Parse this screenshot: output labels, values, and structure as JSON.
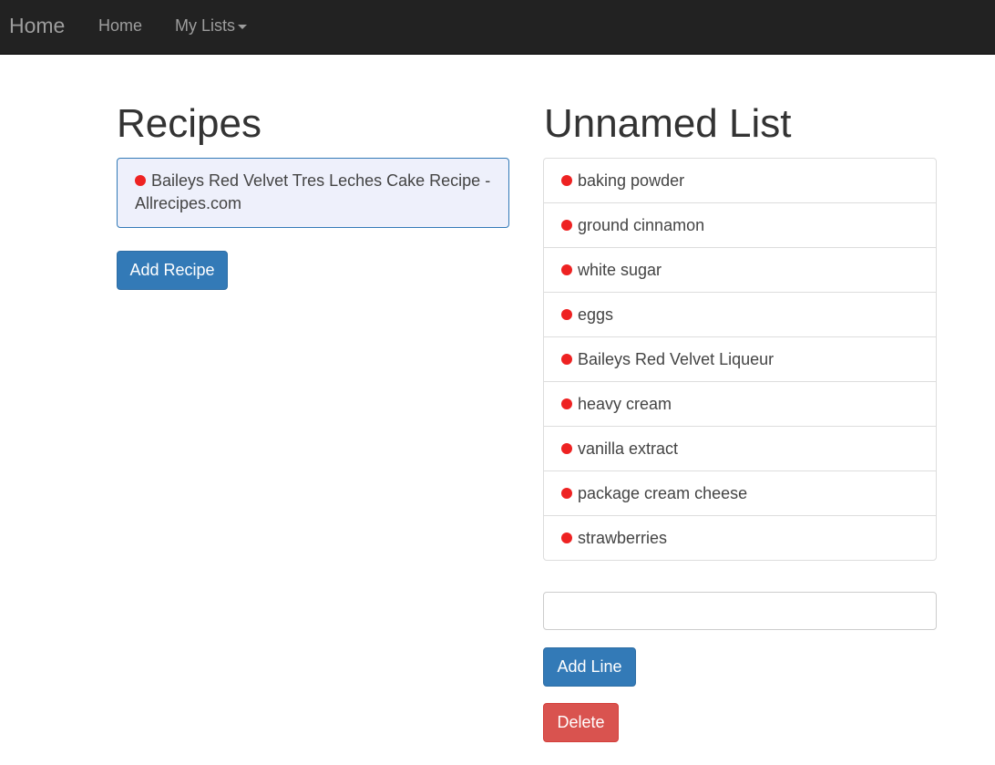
{
  "navbar": {
    "brand": "Home",
    "links": [
      {
        "label": "Home"
      },
      {
        "label": "My Lists",
        "has_dropdown": true
      }
    ]
  },
  "recipes": {
    "heading": "Recipes",
    "items": [
      {
        "label": "Baileys Red Velvet Tres Leches Cake Recipe - Allrecipes.com",
        "status_color": "#ee2222"
      }
    ],
    "add_button": "Add Recipe"
  },
  "list": {
    "heading": "Unnamed List",
    "items": [
      {
        "label": "baking powder",
        "status_color": "#ee2222"
      },
      {
        "label": "ground cinnamon",
        "status_color": "#ee2222"
      },
      {
        "label": "white sugar",
        "status_color": "#ee2222"
      },
      {
        "label": "eggs",
        "status_color": "#ee2222"
      },
      {
        "label": "Baileys Red Velvet Liqueur",
        "status_color": "#ee2222"
      },
      {
        "label": "heavy cream",
        "status_color": "#ee2222"
      },
      {
        "label": "vanilla extract",
        "status_color": "#ee2222"
      },
      {
        "label": "package cream cheese",
        "status_color": "#ee2222"
      },
      {
        "label": "strawberries",
        "status_color": "#ee2222"
      }
    ],
    "input_value": "",
    "input_placeholder": "",
    "add_line_button": "Add Line",
    "delete_button": "Delete"
  },
  "colors": {
    "primary": "#337ab7",
    "danger": "#d9534f",
    "navbar": "#222222",
    "status_dot": "#ee2222"
  }
}
